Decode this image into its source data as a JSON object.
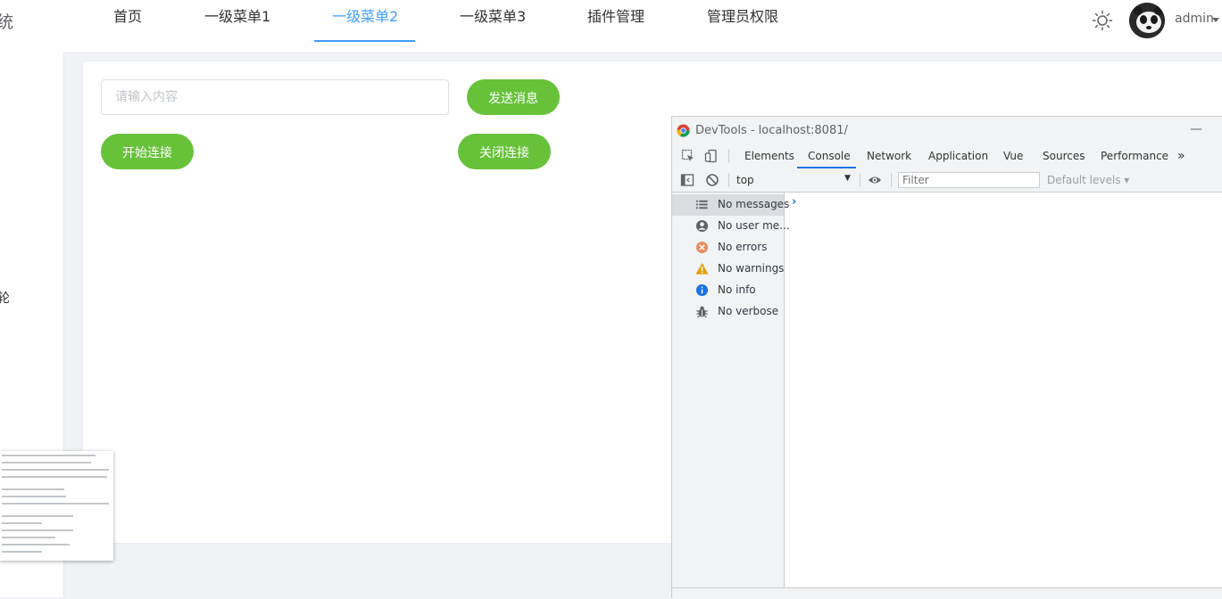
{
  "header": {
    "brand_fragment": "统",
    "nav": [
      {
        "label": "首页",
        "active": false
      },
      {
        "label": "一级菜单1",
        "active": false
      },
      {
        "label": "一级菜单2",
        "active": true
      },
      {
        "label": "一级菜单3",
        "active": false
      },
      {
        "label": "插件管理",
        "active": false
      },
      {
        "label": "管理员权限",
        "active": false
      }
    ],
    "username": "admin",
    "theme_icon": "sun-icon",
    "accent_color": "#409eff"
  },
  "sidebar": {
    "fragment": "轮"
  },
  "main": {
    "message_input": {
      "value": "",
      "placeholder": "请输入内容"
    },
    "send_label": "发送消息",
    "connect_label": "开始连接",
    "disconnect_label": "关闭连接",
    "button_color": "#67c23a"
  },
  "devtools": {
    "title": "DevTools - localhost:8081/",
    "tabs": [
      {
        "label": "Elements",
        "active": false
      },
      {
        "label": "Console",
        "active": true
      },
      {
        "label": "Network",
        "active": false
      },
      {
        "label": "Application",
        "active": false
      },
      {
        "label": "Vue",
        "active": false
      },
      {
        "label": "Sources",
        "active": false
      },
      {
        "label": "Performance",
        "active": false
      }
    ],
    "more_tabs": "»",
    "context": "top",
    "filter_placeholder": "Filter",
    "levels": "Default levels ▾",
    "sidebar": [
      {
        "label": "No messages",
        "icon": "list-icon",
        "active": true
      },
      {
        "label": "No user me...",
        "icon": "user-icon",
        "active": false
      },
      {
        "label": "No errors",
        "icon": "error-icon",
        "active": false
      },
      {
        "label": "No warnings",
        "icon": "warning-icon",
        "active": false
      },
      {
        "label": "No info",
        "icon": "info-icon",
        "active": false
      },
      {
        "label": "No verbose",
        "icon": "bug-icon",
        "active": false
      }
    ],
    "prompt": "›"
  }
}
